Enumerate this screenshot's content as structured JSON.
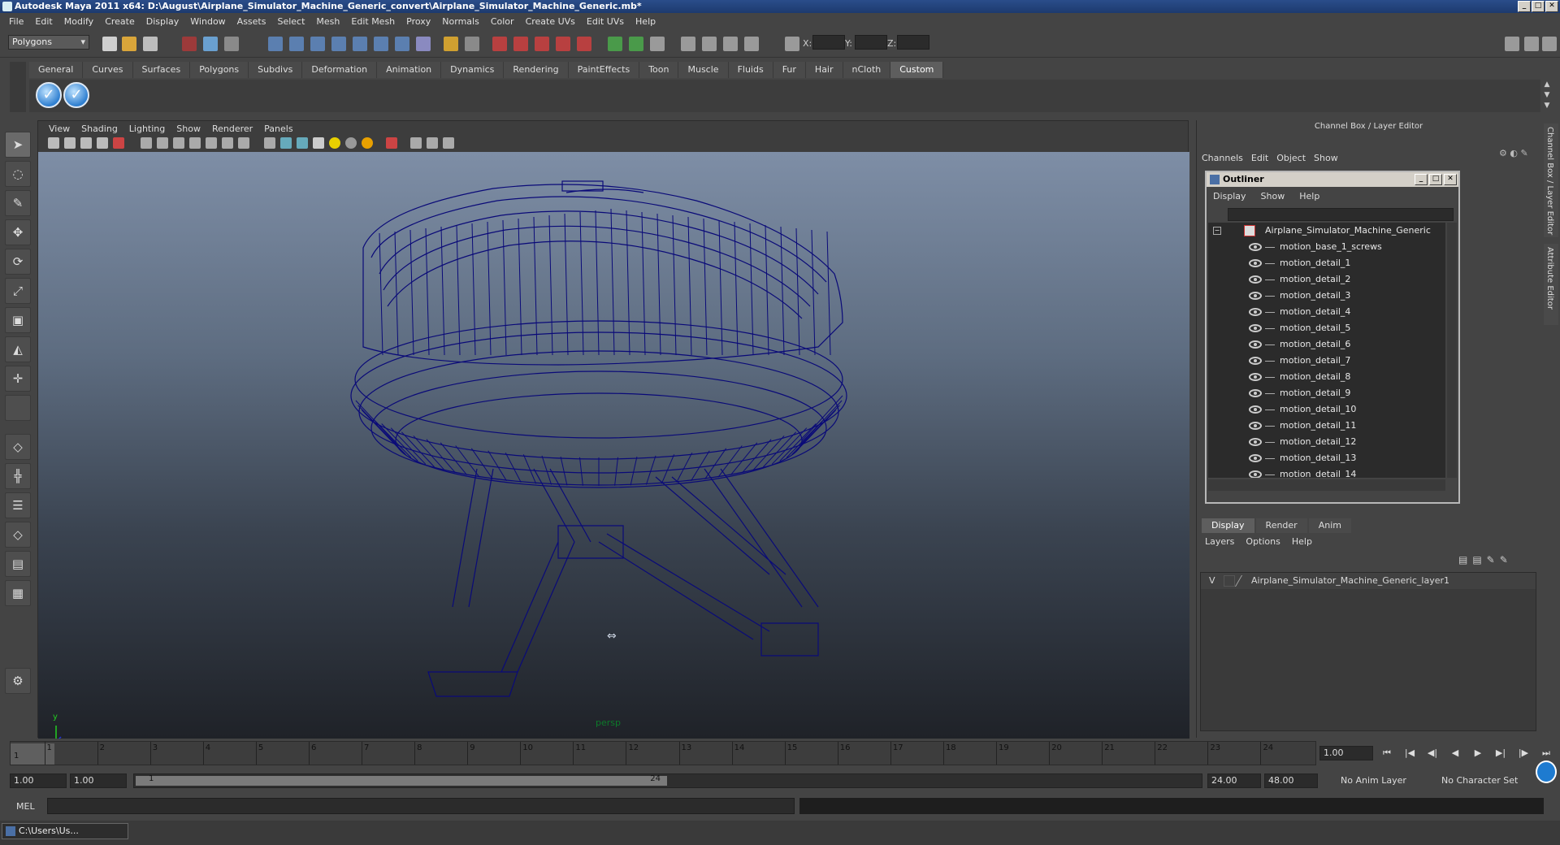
{
  "window": {
    "title": "Autodesk Maya 2011 x64: D:\\August\\Airplane_Simulator_Machine_Generic_convert\\Airplane_Simulator_Machine_Generic.mb*"
  },
  "menubar": [
    "File",
    "Edit",
    "Modify",
    "Create",
    "Display",
    "Window",
    "Assets",
    "Select",
    "Mesh",
    "Edit Mesh",
    "Proxy",
    "Normals",
    "Color",
    "Create UVs",
    "Edit UVs",
    "Help"
  ],
  "statusline": {
    "mode": "Polygons",
    "x_label": "X:",
    "y_label": "Y:",
    "z_label": "Z:"
  },
  "shelf": {
    "tabs": [
      "General",
      "Curves",
      "Surfaces",
      "Polygons",
      "Subdivs",
      "Deformation",
      "Animation",
      "Dynamics",
      "Rendering",
      "PaintEffects",
      "Toon",
      "Muscle",
      "Fluids",
      "Fur",
      "Hair",
      "nCloth",
      "Custom"
    ],
    "active_tab": "Custom"
  },
  "viewport": {
    "menu": [
      "View",
      "Shading",
      "Lighting",
      "Show",
      "Renderer",
      "Panels"
    ],
    "camera_label": "persp",
    "axis_x": "x",
    "axis_y": "y",
    "wire_color": "#0a0a78"
  },
  "channel_box": {
    "title": "Channel Box / Layer Editor",
    "menu": [
      "Channels",
      "Edit",
      "Object",
      "Show"
    ]
  },
  "outliner": {
    "title": "Outliner",
    "menu": [
      "Display",
      "Show",
      "Help"
    ],
    "root": "Airplane_Simulator_Machine_Generic",
    "items": [
      "motion_base_1_screws",
      "motion_detail_1",
      "motion_detail_2",
      "motion_detail_3",
      "motion_detail_4",
      "motion_detail_5",
      "motion_detail_6",
      "motion_detail_7",
      "motion_detail_8",
      "motion_detail_9",
      "motion_detail_10",
      "motion_detail_11",
      "motion_detail_12",
      "motion_detail_13",
      "motion_detail_14"
    ]
  },
  "layer_editor": {
    "tabs": [
      "Display",
      "Render",
      "Anim"
    ],
    "active_tab": "Display",
    "menu": [
      "Layers",
      "Options",
      "Help"
    ],
    "layer_visibility": "V",
    "layer_name": "Airplane_Simulator_Machine_Generic_layer1"
  },
  "side_tabs": [
    "Channel Box / Layer Editor",
    "Attribute Editor"
  ],
  "timeline": {
    "ticks": [
      "1",
      "2",
      "3",
      "4",
      "5",
      "6",
      "7",
      "8",
      "9",
      "10",
      "11",
      "12",
      "13",
      "14",
      "15",
      "16",
      "17",
      "18",
      "19",
      "20",
      "21",
      "22",
      "23",
      "24"
    ],
    "current_frame_marker": "1",
    "current_frame": "1.00"
  },
  "range": {
    "start_time": "1.00",
    "playback_start": "1.00",
    "range_start_label": "1",
    "range_end_label": "24",
    "playback_end": "24.00",
    "end_time": "48.00",
    "anim_layer": "No Anim Layer",
    "character_set": "No Character Set"
  },
  "command_line": {
    "label": "MEL"
  },
  "taskbar": {
    "item": "C:\\Users\\Us..."
  }
}
